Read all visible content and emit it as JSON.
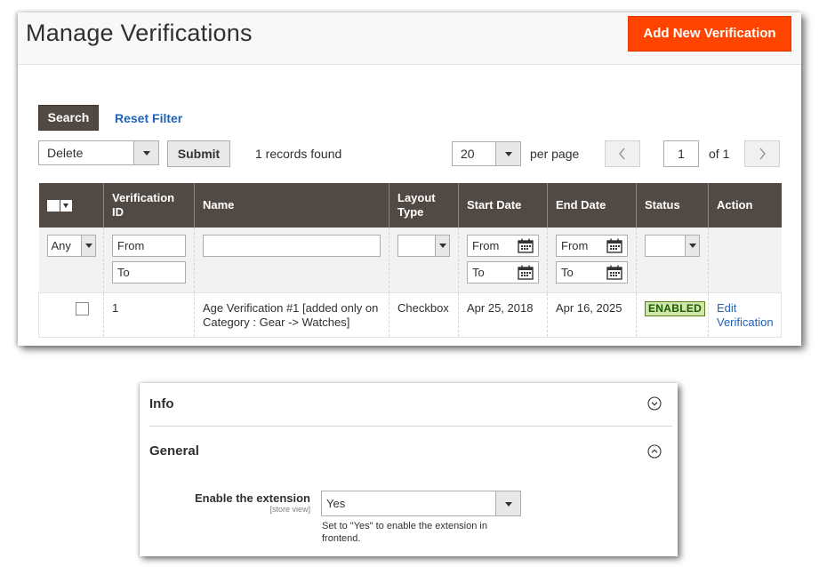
{
  "header": {
    "title": "Manage Verifications",
    "add_button": "Add New Verification"
  },
  "colors": {
    "accent": "#ff4400",
    "header_dark": "#514943",
    "link": "#1f62b6",
    "enabled_bg": "#d0e5a9"
  },
  "filters": {
    "search_button": "Search",
    "reset_link": "Reset Filter"
  },
  "massaction": {
    "selected": "Delete",
    "submit_label": "Submit",
    "records_found": "1 records found"
  },
  "pager": {
    "per_page_value": "20",
    "per_page_label": "per page",
    "current_page": "1",
    "of_label": "of 1",
    "prev_icon": "chevron-left-icon",
    "next_icon": "chevron-right-icon"
  },
  "grid": {
    "columns": [
      {
        "key": "select",
        "label": ""
      },
      {
        "key": "id",
        "label": "Verification ID"
      },
      {
        "key": "name",
        "label": "Name"
      },
      {
        "key": "layout",
        "label": "Layout Type"
      },
      {
        "key": "start",
        "label": "Start Date"
      },
      {
        "key": "end",
        "label": "End Date"
      },
      {
        "key": "status",
        "label": "Status"
      },
      {
        "key": "action",
        "label": "Action"
      }
    ],
    "filter": {
      "select_any": "Any",
      "id_from": "From",
      "id_to": "To",
      "name": "",
      "layout": "",
      "start_from": "From",
      "start_to": "To",
      "end_from": "From",
      "end_to": "To",
      "status": ""
    },
    "rows": [
      {
        "id": "1",
        "name": "Age Verification #1 [added only on Category : Gear -> Watches]",
        "layout": "Checkbox",
        "start": "Apr 25, 2018",
        "end": "Apr 16, 2025",
        "status": "ENABLED",
        "action": "Edit Verification"
      }
    ]
  },
  "config": {
    "sections": [
      {
        "title": "Info",
        "state": "collapsed",
        "icon": "chevron-circle-down-icon"
      },
      {
        "title": "General",
        "state": "expanded",
        "icon": "chevron-circle-up-icon"
      }
    ],
    "field": {
      "label": "Enable the extension",
      "scope": "[store view]",
      "value": "Yes",
      "note": "Set to \"Yes\" to enable the extension in frontend."
    }
  }
}
